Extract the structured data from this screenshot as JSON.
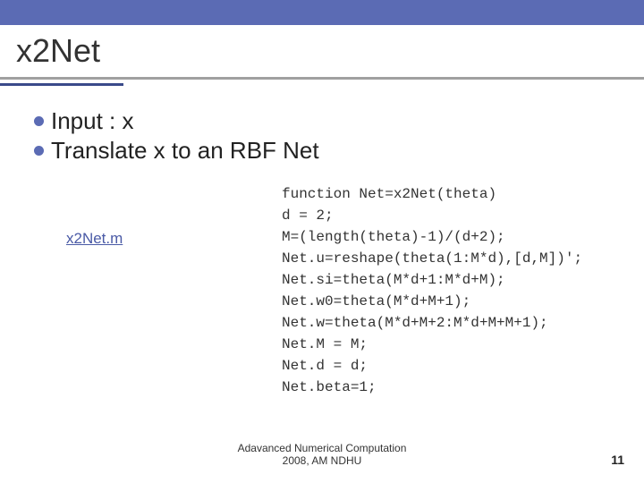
{
  "title": "x2Net",
  "bullets": [
    "Input : x",
    "Translate x to an RBF Net"
  ],
  "link": "x2Net.m",
  "code_lines": [
    "function Net=x2Net(theta)",
    "d = 2;",
    "M=(length(theta)-1)/(d+2);",
    "Net.u=reshape(theta(1:M*d),[d,M])';",
    "Net.si=theta(M*d+1:M*d+M);",
    "Net.w0=theta(M*d+M+1);",
    "Net.w=theta(M*d+M+2:M*d+M+M+1);",
    "Net.M = M;",
    "Net.d = d;",
    "Net.beta=1;"
  ],
  "footer_line1": "Adavanced Numerical Computation",
  "footer_line2": "2008, AM NDHU",
  "page_number": "11"
}
